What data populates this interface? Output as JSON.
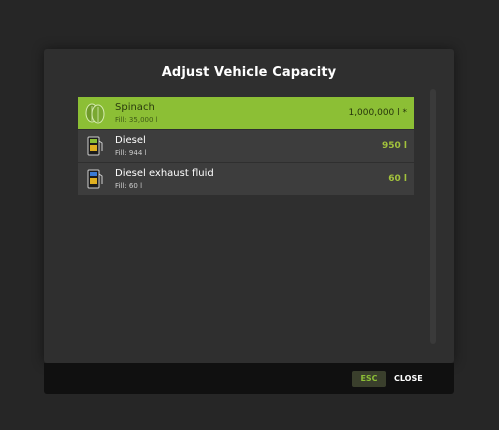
{
  "dialog": {
    "title": "Adjust Vehicle Capacity",
    "items": [
      {
        "name": "Spinach",
        "fill": "Fill: 35,000 l",
        "capacity": "1,000,000 l *",
        "icon": "leaf-icon",
        "selected": true
      },
      {
        "name": "Diesel",
        "fill": "Fill: 944 l",
        "capacity": "950 l",
        "icon": "fuel-pump-icon",
        "selected": false
      },
      {
        "name": "Diesel exhaust fluid",
        "fill": "Fill: 60 l",
        "capacity": "60 l",
        "icon": "def-pump-icon",
        "selected": false
      }
    ]
  },
  "footer": {
    "esc_key": "ESC",
    "close_label": "CLOSE"
  },
  "colors": {
    "accent": "#8cbf35",
    "capacity_text": "#a2c23c",
    "background": "#262626",
    "dialog": "#2f2f2f",
    "row": "#3d3d3d",
    "footer": "#101010"
  }
}
